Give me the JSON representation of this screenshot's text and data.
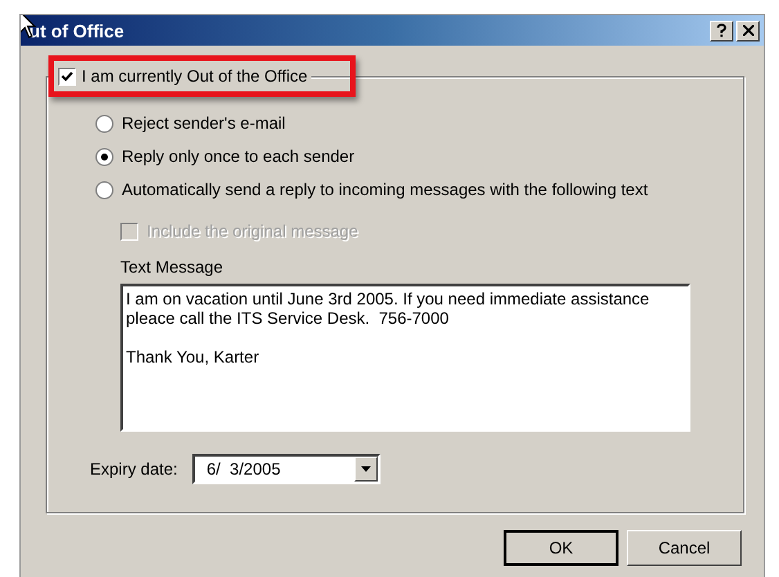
{
  "window": {
    "title": "ut of Office"
  },
  "out_of_office": {
    "label": "I am currently Out of the Office",
    "checked": true,
    "highlighted": true
  },
  "options": [
    {
      "label": "Reject sender's e-mail",
      "selected": false
    },
    {
      "label": "Reply only once to each sender",
      "selected": true
    },
    {
      "label": "Automatically send a reply to incoming messages with the following text",
      "selected": false
    }
  ],
  "include_original": {
    "label": "Include the original message",
    "checked": false,
    "disabled": true
  },
  "text_message": {
    "label": "Text Message",
    "value": "I am on vacation until June 3rd 2005. If you need immediate assistance\npleace call the ITS Service Desk.  756-7000\n\nThank You, Karter"
  },
  "expiry": {
    "label": "Expiry date:",
    "value": "6/  3/2005"
  },
  "buttons": [
    {
      "label": "OK",
      "default": true
    },
    {
      "label": "Cancel",
      "default": false
    }
  ]
}
